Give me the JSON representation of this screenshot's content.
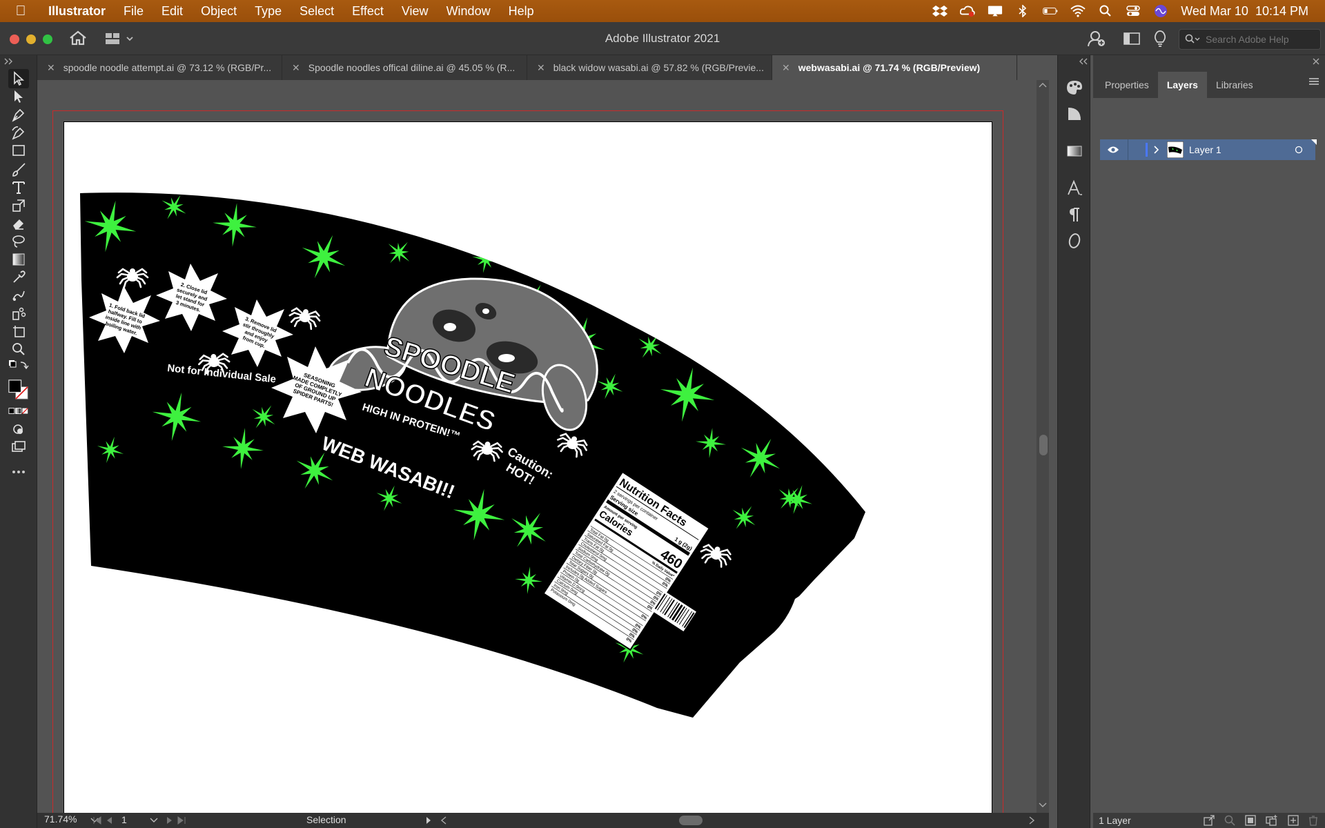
{
  "menubar": {
    "app_name": "Illustrator",
    "items": [
      "File",
      "Edit",
      "Object",
      "Type",
      "Select",
      "Effect",
      "View",
      "Window",
      "Help"
    ],
    "clock": "Wed Mar 10  10:14 PM"
  },
  "window": {
    "title": "Adobe Illustrator 2021",
    "search_placeholder": "Search Adobe Help"
  },
  "tabs": [
    {
      "label": "spoodle noodle attempt.ai @ 73.12 % (RGB/Pr..."
    },
    {
      "label": "Spoodle noodles offical diline.ai @ 45.05 % (R..."
    },
    {
      "label": "black widow wasabi.ai @ 57.82 % (RGB/Previe..."
    },
    {
      "label": "webwasabi.ai @ 71.74 % (RGB/Preview)"
    }
  ],
  "artwork": {
    "brand_line1": "SPOODLE",
    "brand_line2": "NOODLES",
    "tagline": "HIGH IN PROTEIN!™",
    "flavor": "WEB WASABI!!",
    "caution_line1": "Caution:",
    "caution_line2": "HOT!",
    "not_for_sale": "Not for Individual Sale",
    "step1": [
      "1. Fold back lid",
      "halfway. Fill to",
      "inside line with",
      "boiling water."
    ],
    "step2": [
      "2. Close lid",
      "securely and",
      "let stand for",
      "3 minutes."
    ],
    "step3": [
      "3. Remove lid",
      "stir throughly",
      "and enjoy",
      "from cup."
    ],
    "seasoning": [
      "SEASONING",
      "MADE COMPLETLY",
      "OF GROUND UP",
      "SPIDER PARTS!"
    ],
    "nutrition": {
      "title": "Nutrition Facts",
      "servings": "2 servings per container",
      "serving_size_label": "Serving size",
      "serving_size_value": "1 g (2g)",
      "amount_label": "Amount per serving",
      "calories_label": "Calories",
      "calories_value": "460",
      "dv_label": "% Daily Value*",
      "rows": [
        {
          "label": "Total Fat 0g",
          "dv": "0%"
        },
        {
          "label": "Saturated Fat 0g",
          "dv": "0%"
        },
        {
          "label": "Trans Fat 0g",
          "dv": ""
        },
        {
          "label": "Cholesterol 0mg",
          "dv": "0%"
        },
        {
          "label": "Sodium 0mg",
          "dv": "0%"
        },
        {
          "label": "Total Carbohydrate 0g",
          "dv": "0%"
        },
        {
          "label": "Dietary Fiber 0g",
          "dv": "0%"
        },
        {
          "label": "Total Sugars 0g",
          "dv": ""
        },
        {
          "label": "Includes 0g Added Sugars",
          "dv": "0%"
        },
        {
          "label": "Protein 0g",
          "dv": ""
        },
        {
          "label": "Vitamin D 0mcg",
          "dv": "0%"
        },
        {
          "label": "Calcium 0mg",
          "dv": "0%"
        },
        {
          "label": "Iron 0mg",
          "dv": "0%"
        },
        {
          "label": "Potassium 0mg",
          "dv": "0%"
        }
      ]
    }
  },
  "status": {
    "zoom": "71.74%",
    "artboard_number": "1",
    "tool_label": "Selection"
  },
  "panel": {
    "tabs": [
      "Properties",
      "Layers",
      "Libraries"
    ],
    "active_tab": "Layers",
    "layer_name": "Layer 1",
    "layer_count": "1 Layer"
  },
  "colors": {
    "menubar": "#a2550e",
    "chrome_dark": "#323232",
    "canvas": "#535353",
    "selected_layer": "#4f6b95",
    "neon_green": "#3ef13f"
  }
}
